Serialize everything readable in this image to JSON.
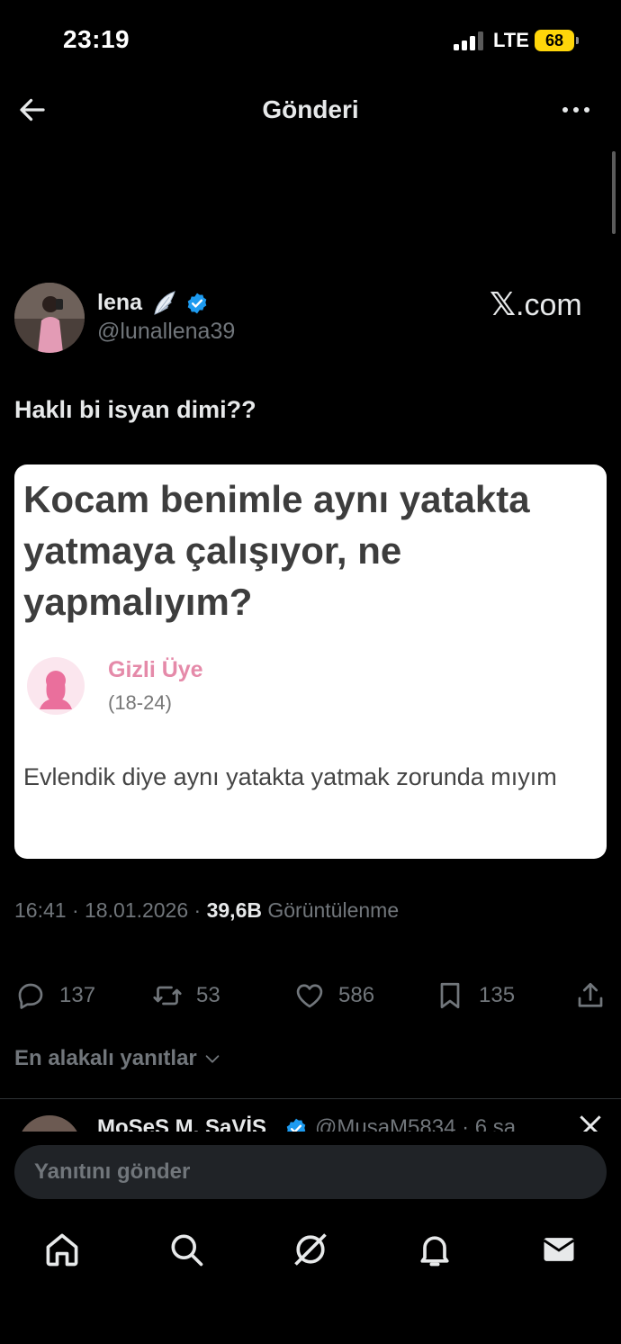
{
  "status_bar": {
    "time": "23:19",
    "network": "LTE",
    "battery": "68"
  },
  "header": {
    "title": "Gönderi"
  },
  "post": {
    "display_name": "lena",
    "handle": "@lunallena39",
    "source": ".com",
    "text": "Haklı bi isyan dimi??",
    "media": {
      "headline": "Kocam benimle aynı yatakta yatmaya çalışıyor, ne yapmalıyım?",
      "user": "Gizli Üye",
      "age": "(18-24)",
      "body": "Evlendik diye aynı yatakta yatmak zorunda mıyım"
    },
    "time": "16:41",
    "date": "18.01.2026",
    "views": "39,6B",
    "views_label": "Görüntülenme",
    "separator": "·"
  },
  "actions": {
    "replies": "137",
    "reposts": "53",
    "likes": "586",
    "bookmarks": "135"
  },
  "replies_sort": {
    "label": "En alakalı yanıtlar"
  },
  "reply_preview": {
    "name": "MoSeS M. SaVİS",
    "handle_time": "@MusaM5834 · 6 sa"
  },
  "composer": {
    "placeholder": "Yanıtını gönder"
  },
  "colors": {
    "verified": "#1d9bf0",
    "battery": "#ffd60a",
    "muted": "#71767b"
  },
  "icons": {
    "back": "arrow-left-icon",
    "more": "more-horizontal-icon",
    "reply": "comment-icon",
    "repost": "repost-icon",
    "like": "heart-icon",
    "bookmark": "bookmark-icon",
    "share": "share-icon",
    "home": "home-icon",
    "search": "search-icon",
    "grok": "grok-icon",
    "notifications": "bell-icon",
    "messages": "envelope-icon"
  }
}
